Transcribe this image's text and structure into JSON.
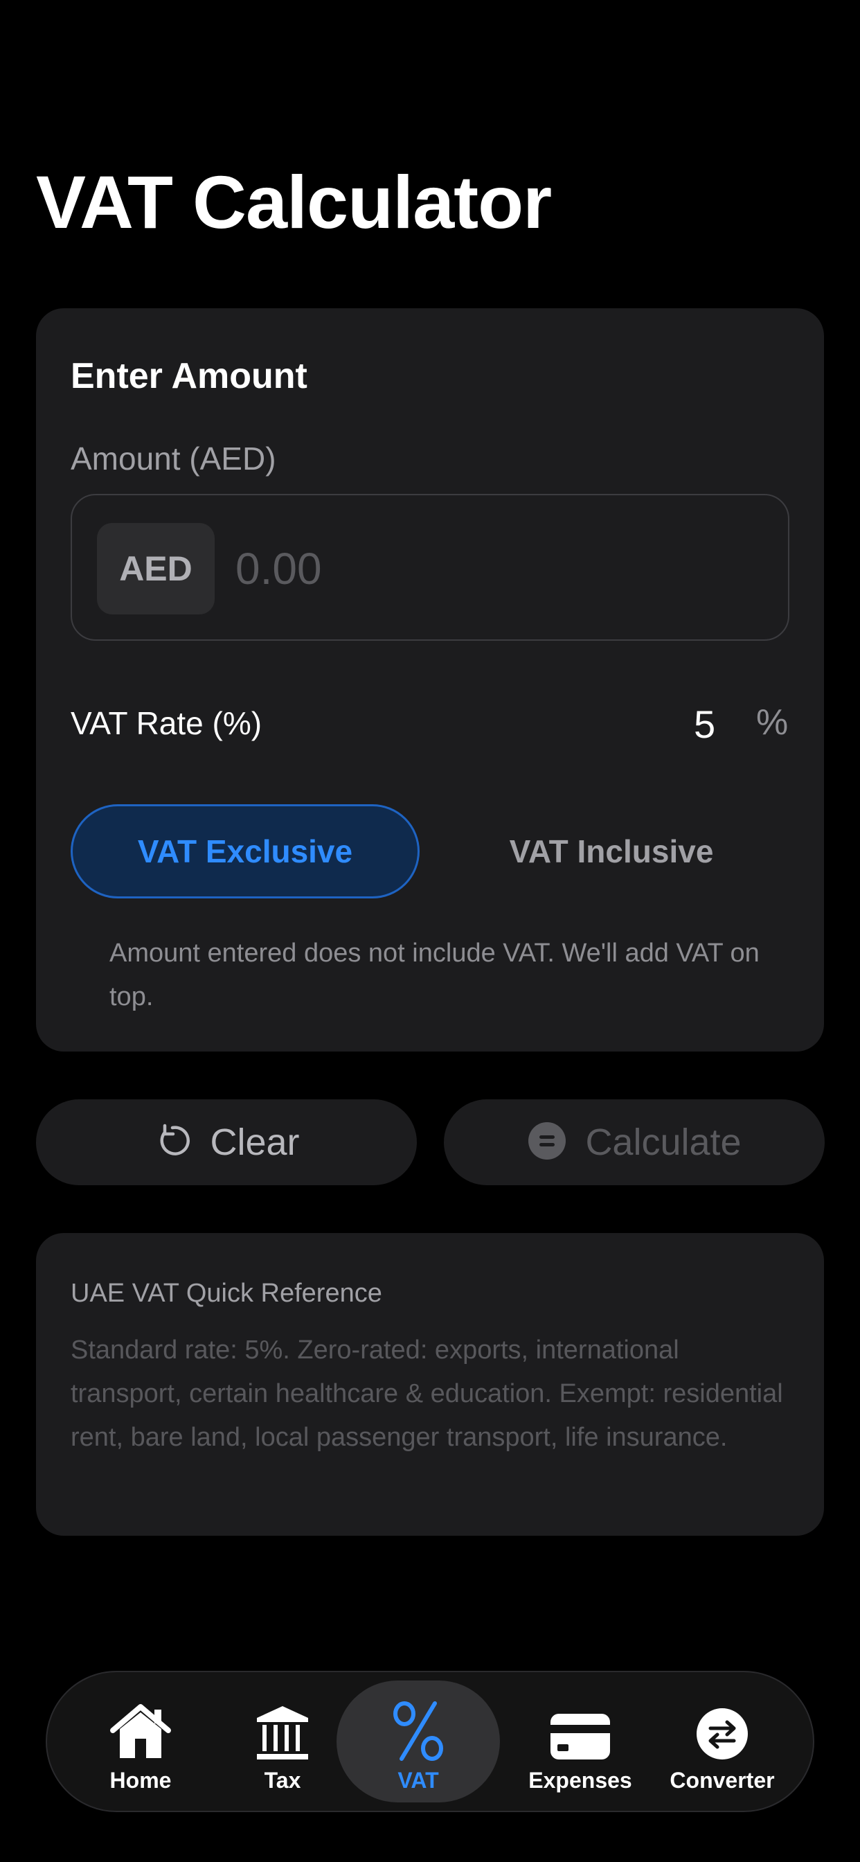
{
  "page": {
    "title": "VAT Calculator"
  },
  "amount_card": {
    "heading": "Enter Amount",
    "field_label": "Amount (AED)",
    "currency": "AED",
    "amount_placeholder": "0.00",
    "amount_value": "",
    "vat_rate_label": "VAT Rate (%)",
    "vat_rate_value": "5",
    "vat_rate_unit": "%",
    "modes": [
      {
        "label": "VAT Exclusive",
        "selected": true
      },
      {
        "label": "VAT Inclusive",
        "selected": false
      }
    ],
    "mode_description": "Amount entered does not include VAT. We'll add VAT on top."
  },
  "actions": {
    "clear_label": "Clear",
    "clear_icon": "reset-icon",
    "calculate_label": "Calculate",
    "calculate_icon": "equals-icon",
    "calculate_enabled": false
  },
  "reference": {
    "title": "UAE VAT Quick Reference",
    "body": "Standard rate: 5%. Zero-rated: exports, international transport, certain healthcare & education. Exempt: residential rent, bare land, local passenger transport, life insurance."
  },
  "tabbar": {
    "items": [
      {
        "label": "Home",
        "icon": "home-icon",
        "active": false
      },
      {
        "label": "Tax",
        "icon": "bank-icon",
        "active": false
      },
      {
        "label": "VAT",
        "icon": "percent-icon",
        "active": true
      },
      {
        "label": "Expenses",
        "icon": "card-icon",
        "active": false
      },
      {
        "label": "Converter",
        "icon": "arrows-icon",
        "active": false
      }
    ]
  },
  "colors": {
    "background": "#000000",
    "card": "#1c1c1e",
    "accent": "#2f8cff",
    "accent_fill": "#0f2a4d",
    "muted_text": "#a1a1a6"
  }
}
